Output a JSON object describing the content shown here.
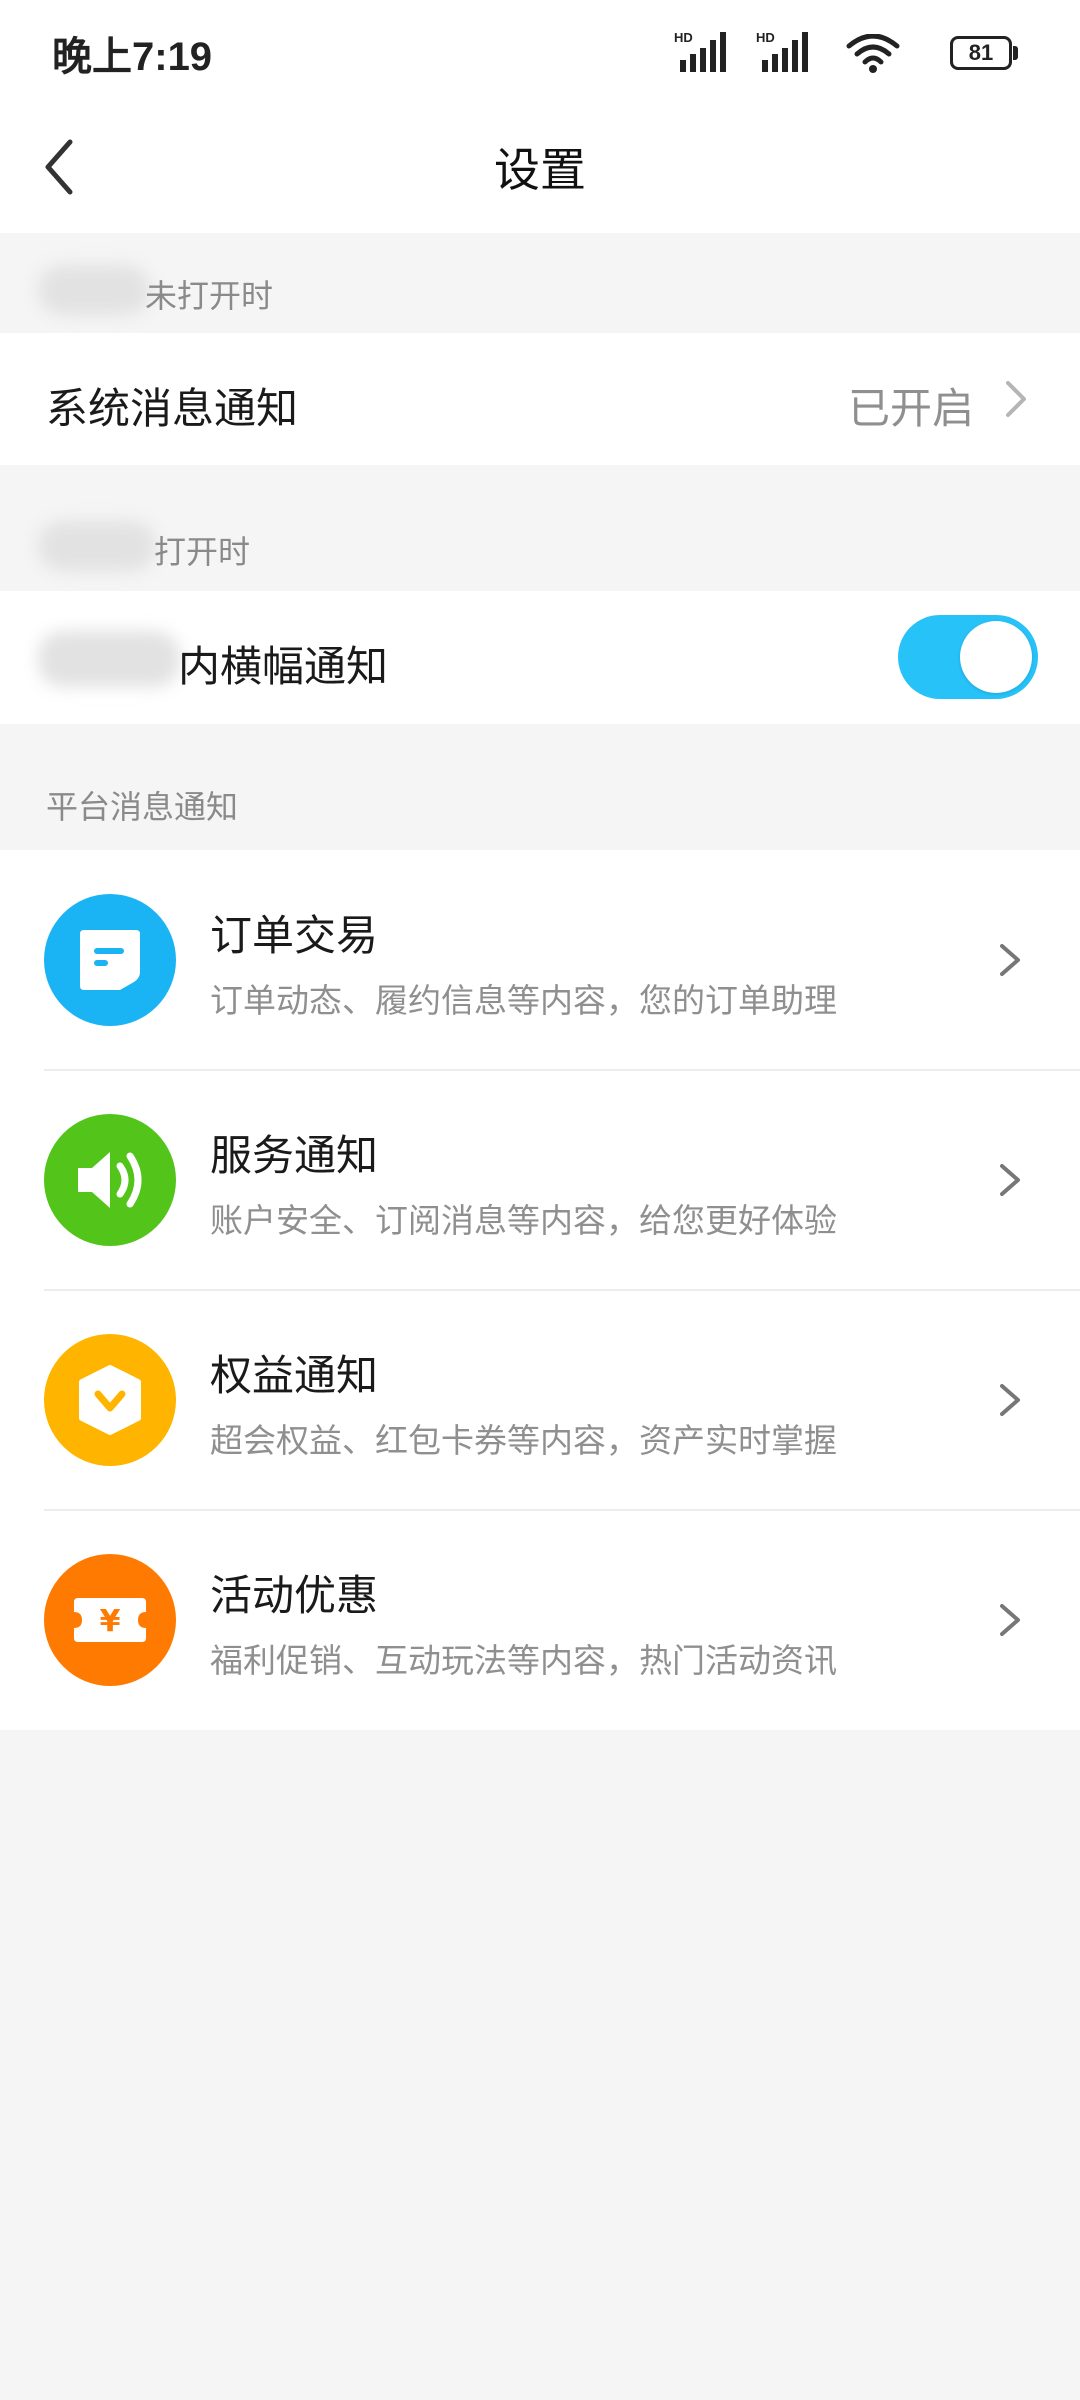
{
  "status_bar": {
    "time": "晚上7:19",
    "signal_1_label": "HD",
    "signal_2_label": "HD",
    "battery_level": "81"
  },
  "nav": {
    "title": "设置"
  },
  "sections": {
    "closed_label": "未打开时",
    "open_label": "打开时",
    "platform_label": "平台消息通知"
  },
  "system_notification": {
    "title": "系统消息通知",
    "value": "已开启"
  },
  "banner_notification": {
    "title": "内横幅通知",
    "enabled": true
  },
  "platform_items": [
    {
      "title": "订单交易",
      "desc": "订单动态、履约信息等内容，您的订单助理",
      "icon": "order-icon",
      "color": "#1ab4f5"
    },
    {
      "title": "服务通知",
      "desc": "账户安全、订阅消息等内容，给您更好体验",
      "icon": "speaker-icon",
      "color": "#52c41a"
    },
    {
      "title": "权益通知",
      "desc": "超会权益、红包卡券等内容，资产实时掌握",
      "icon": "benefit-icon",
      "color": "#ffb400"
    },
    {
      "title": "活动优惠",
      "desc": "福利促销、互动玩法等内容，热门活动资讯",
      "icon": "ticket-icon",
      "color": "#ff7a00"
    }
  ],
  "colors": {
    "toggle_on": "#27c2f8",
    "background": "#f5f5f5"
  }
}
